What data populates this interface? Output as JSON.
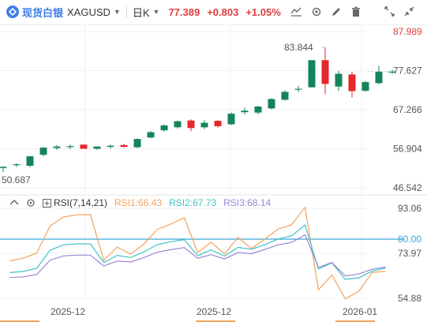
{
  "header": {
    "brand": "现货白银",
    "symbol": "XAGUSD",
    "timeframe": "日K",
    "price": "77.389",
    "change": "+0.803",
    "change_pct": "+1.05%",
    "up_color": "#e03d3d"
  },
  "toolbar_icons": [
    "chart-line-icon",
    "settings-icon",
    "draw-icon",
    "delete-icon",
    "expand-icon",
    "collapse-icon"
  ],
  "rsi_legend": {
    "name": "RSI(7,14,21)",
    "rsi1": "RSI1:66.43",
    "rsi2": "RSI2:67.73",
    "rsi3": "RSI3:68.14"
  },
  "chart_data": [
    {
      "type": "candlestick",
      "up_color": "#e5262b",
      "down_color": "#14845a",
      "ylim": [
        46.542,
        87.989
      ],
      "y_ticks": [
        "87.989",
        "77.627",
        "67.266",
        "56.904",
        "46.542"
      ],
      "x_ticks": [
        "2025-12",
        "2025-12",
        "2026-01"
      ],
      "annotations": {
        "max": "83.844",
        "min": "50.687"
      },
      "candles": [
        {
          "o": 51.8,
          "h": 52.3,
          "l": 50.7,
          "c": 52.1
        },
        {
          "o": 52.6,
          "h": 53.0,
          "l": 52.1,
          "c": 52.8
        },
        {
          "o": 52.4,
          "h": 55.0,
          "l": 52.1,
          "c": 54.9
        },
        {
          "o": 55.3,
          "h": 57.4,
          "l": 54.9,
          "c": 57.2
        },
        {
          "o": 57.1,
          "h": 57.9,
          "l": 56.6,
          "c": 57.5
        },
        {
          "o": 57.6,
          "h": 58.0,
          "l": 56.8,
          "c": 57.6
        },
        {
          "o": 58.0,
          "h": 58.1,
          "l": 56.9,
          "c": 56.9
        },
        {
          "o": 56.9,
          "h": 57.4,
          "l": 56.6,
          "c": 57.5
        },
        {
          "o": 57.4,
          "h": 58.0,
          "l": 56.9,
          "c": 57.7
        },
        {
          "o": 57.9,
          "h": 58.2,
          "l": 57.3,
          "c": 57.4
        },
        {
          "o": 57.3,
          "h": 59.6,
          "l": 57.1,
          "c": 59.5
        },
        {
          "o": 59.9,
          "h": 61.6,
          "l": 59.7,
          "c": 61.3
        },
        {
          "o": 61.8,
          "h": 63.3,
          "l": 61.5,
          "c": 63.1
        },
        {
          "o": 62.6,
          "h": 64.4,
          "l": 62.3,
          "c": 64.2
        },
        {
          "o": 64.4,
          "h": 64.7,
          "l": 61.6,
          "c": 62.4
        },
        {
          "o": 62.6,
          "h": 64.5,
          "l": 62.1,
          "c": 63.8
        },
        {
          "o": 64.3,
          "h": 64.5,
          "l": 62.5,
          "c": 62.9
        },
        {
          "o": 63.4,
          "h": 66.5,
          "l": 63.2,
          "c": 66.2
        },
        {
          "o": 66.6,
          "h": 67.8,
          "l": 66.0,
          "c": 67.0
        },
        {
          "o": 66.5,
          "h": 68.3,
          "l": 66.0,
          "c": 68.1
        },
        {
          "o": 67.6,
          "h": 70.3,
          "l": 67.4,
          "c": 70.1
        },
        {
          "o": 69.9,
          "h": 72.4,
          "l": 69.7,
          "c": 72.0
        },
        {
          "o": 72.8,
          "h": 73.6,
          "l": 71.9,
          "c": 72.8
        },
        {
          "o": 73.2,
          "h": 80.4,
          "l": 73.2,
          "c": 80.4
        },
        {
          "o": 80.4,
          "h": 83.844,
          "l": 71.4,
          "c": 74.1
        },
        {
          "o": 73.4,
          "h": 77.6,
          "l": 72.2,
          "c": 76.8
        },
        {
          "o": 76.6,
          "h": 77.3,
          "l": 70.5,
          "c": 72.2
        },
        {
          "o": 72.3,
          "h": 74.9,
          "l": 72.0,
          "c": 74.6
        },
        {
          "o": 74.3,
          "h": 78.9,
          "l": 74.0,
          "c": 77.4
        },
        {
          "o": 77.1,
          "h": 77.9,
          "l": 76.8,
          "c": 77.4
        }
      ]
    },
    {
      "type": "line",
      "title": "RSI(7,14,21)",
      "ylim": [
        54.88,
        93.06
      ],
      "y_ticks": [
        "93.06",
        "80.00",
        "73.97",
        "54.88"
      ],
      "reference_line": 80.0,
      "reference_color": "#3aa6d8",
      "series": [
        {
          "name": "RSI1",
          "color": "#f4a35e",
          "values": [
            70.8,
            71.9,
            74.1,
            85.6,
            89.4,
            90.3,
            90.4,
            71.0,
            76.6,
            73.6,
            78.0,
            84.2,
            86.4,
            89.1,
            74.4,
            78.7,
            73.7,
            80.7,
            76.0,
            80.0,
            84.3,
            86.1,
            93.5,
            58.5,
            64.8,
            54.6,
            57.9,
            65.8,
            66.43
          ]
        },
        {
          "name": "RSI2",
          "color": "#3cc4c4",
          "values": [
            65.8,
            66.3,
            67.6,
            75.3,
            77.6,
            78.0,
            78.0,
            70.1,
            73.1,
            72.2,
            74.6,
            77.7,
            78.9,
            79.8,
            73.0,
            75.4,
            72.8,
            76.5,
            75.7,
            77.7,
            80.1,
            81.4,
            86.0,
            67.3,
            70.0,
            62.9,
            63.6,
            66.4,
            67.73
          ]
        },
        {
          "name": "RSI3",
          "color": "#9a86d6",
          "values": [
            63.7,
            64.0,
            65.0,
            71.1,
            72.9,
            73.2,
            73.2,
            68.6,
            70.7,
            70.3,
            72.2,
            74.5,
            75.5,
            76.4,
            71.9,
            73.4,
            71.6,
            74.3,
            73.8,
            75.6,
            77.6,
            78.6,
            81.8,
            68.0,
            70.1,
            64.4,
            65.2,
            67.2,
            68.14
          ]
        }
      ]
    }
  ]
}
